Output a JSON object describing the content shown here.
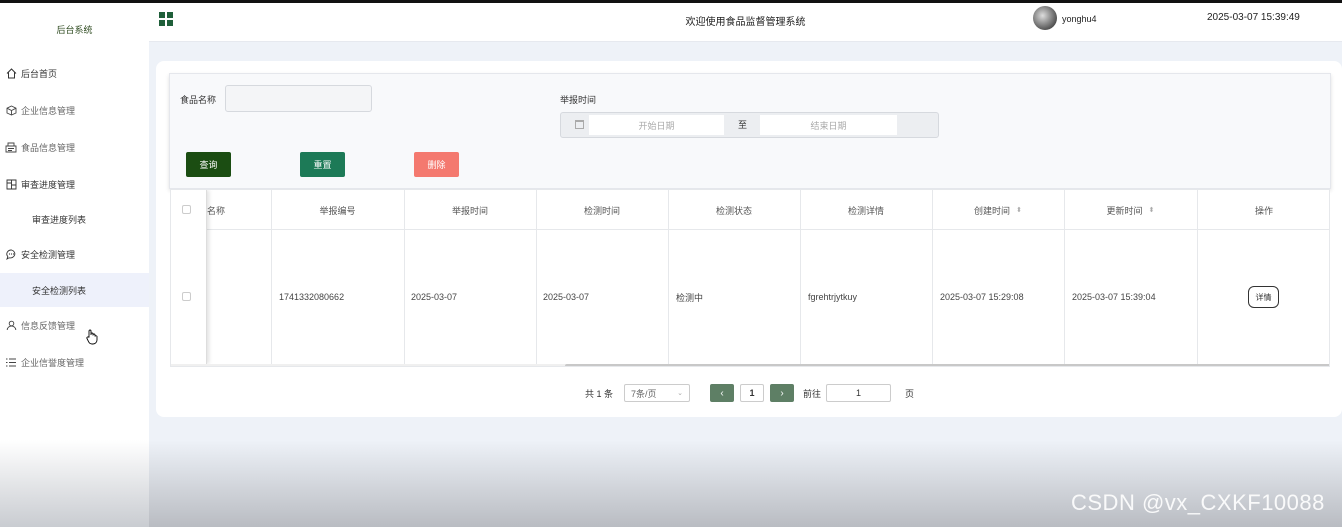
{
  "sidebar": {
    "brand": "后台系统",
    "items": [
      {
        "label": "后台首页",
        "icon": "home-icon"
      },
      {
        "label": "企业信息管理",
        "icon": "cube-icon"
      },
      {
        "label": "食品信息管理",
        "icon": "document-icon"
      },
      {
        "label": "审查进度管理",
        "icon": "columns-icon"
      },
      {
        "label": "审查进度列表"
      },
      {
        "label": "安全检测管理",
        "icon": "chat-icon"
      },
      {
        "label": "安全检测列表"
      },
      {
        "label": "信息反馈管理",
        "icon": "user-icon"
      },
      {
        "label": "企业信誉度管理",
        "icon": "list-icon"
      }
    ]
  },
  "header": {
    "welcome": "欢迎使用食品监督管理系统",
    "username": "yonghu4",
    "datetime": "2025-03-07 15:39:49"
  },
  "search": {
    "food_name_label": "食品名称",
    "report_time_label": "举报时间",
    "start_placeholder": "开始日期",
    "range_separator": "至",
    "end_placeholder": "结束日期",
    "query_button": "查询",
    "reset_button": "重置",
    "delete_button": "删除"
  },
  "table": {
    "columns": [
      "名称",
      "举报编号",
      "举报时间",
      "检测时间",
      "检测状态",
      "检测详情",
      "创建时间",
      "更新时间",
      "操作"
    ],
    "rows": [
      {
        "name": "",
        "report_no": "1741332080662",
        "report_time": "2025-03-07",
        "check_time": "2025-03-07",
        "status": "检测中",
        "detail": "fgrehtrjytkuy",
        "created": "2025-03-07 15:29:08",
        "updated": "2025-03-07 15:39:04",
        "action": "详情"
      }
    ]
  },
  "pagination": {
    "total": "共 1 条",
    "page_size": "7条/页",
    "current_page": "1",
    "goto_label": "前往",
    "goto_value": "1",
    "page_suffix": "页"
  },
  "watermark": "CSDN @vx_CXKF10088",
  "colors": {
    "query": "#1b4d12",
    "reset": "#1d7a57",
    "delete": "#f4796f",
    "pager": "#5e7f65"
  }
}
